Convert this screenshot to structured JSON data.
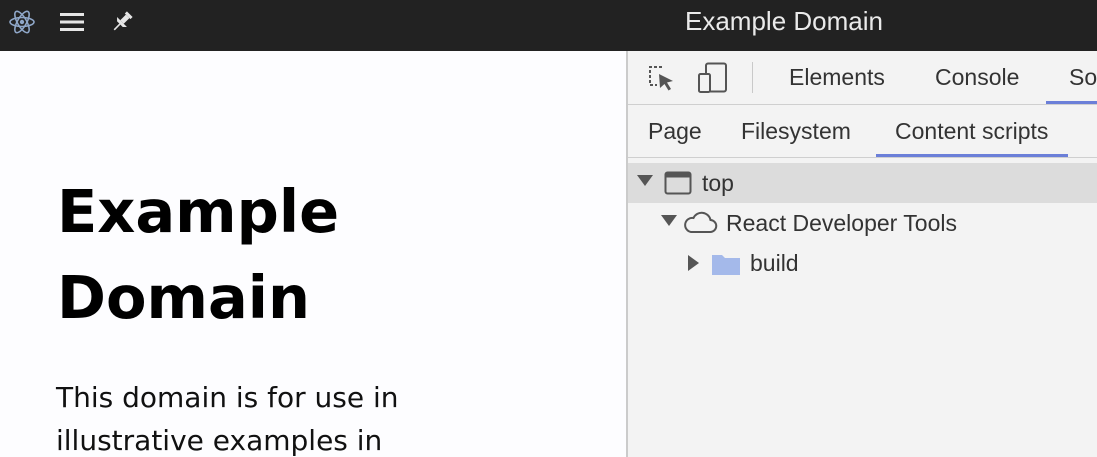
{
  "app": {
    "title": "Example Domain"
  },
  "page": {
    "heading": "Example Domain",
    "paragraph": "This domain is for use in illustrative examples in"
  },
  "devtools": {
    "main_tabs": [
      {
        "label": "Elements"
      },
      {
        "label": "Console"
      },
      {
        "label": "So"
      }
    ],
    "sub_tabs": [
      {
        "label": "Page"
      },
      {
        "label": "Filesystem"
      },
      {
        "label": "Content scripts"
      }
    ],
    "tree": {
      "top": "top",
      "extension": "React Developer Tools",
      "folder": "build"
    }
  },
  "colors": {
    "accent": "#6b7fd8",
    "titlebar": "#222222",
    "folder": "#a4b9ea"
  },
  "icons": [
    "electron-logo-icon",
    "hamburger-menu-icon",
    "pin-icon",
    "inspect-element-icon",
    "device-toggle-icon",
    "frame-icon",
    "cloud-icon",
    "folder-icon"
  ]
}
